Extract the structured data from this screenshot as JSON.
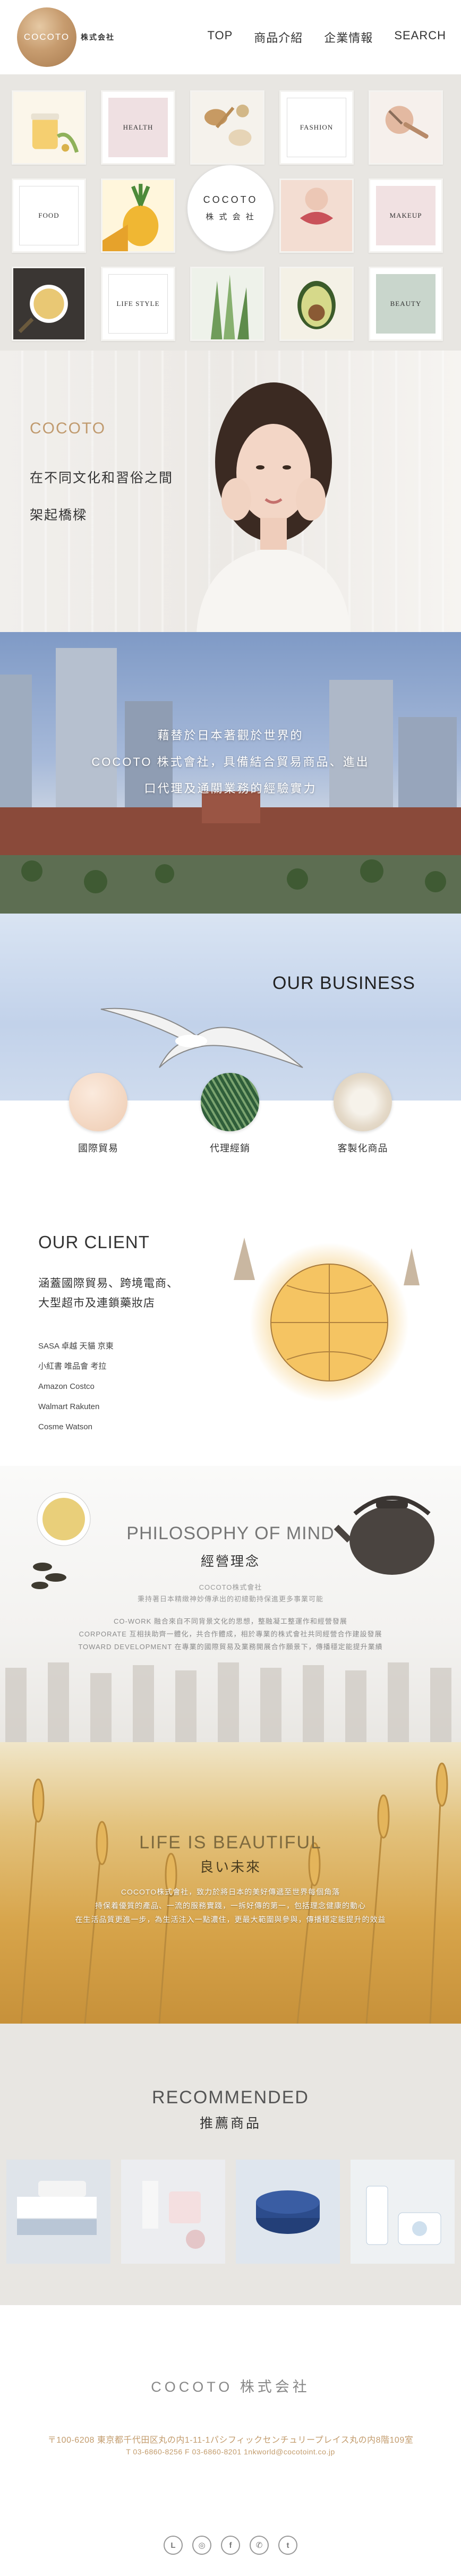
{
  "header": {
    "logo_circle_text": "COCOTO",
    "logo_text": "株式会社",
    "nav": [
      "TOP",
      "商品介紹",
      "企業情報",
      "SEARCH"
    ]
  },
  "grid": {
    "text_tiles": {
      "health": "HEALTH",
      "fashion": "FASHION",
      "food": "FOOD",
      "makeup": "MAKEUP",
      "lifestyle": "LIFE STYLE",
      "beauty": "BEAUTY"
    },
    "center_brand": "COCOTO",
    "center_sub": "株 式 会 社"
  },
  "hero": {
    "brand": "COCOTO",
    "line1": "在不同文化和習俗之間",
    "line2": "架起橋樑"
  },
  "city": {
    "lines": [
      "藉替於日本著觀於世界的",
      "COCOTO 株式會社，具備結合貿易商品、進出",
      "口代理及通關業務的經驗實力"
    ]
  },
  "business": {
    "title": "OUR BUSINESS",
    "items": [
      "國際貿易",
      "代理經銷",
      "客製化商品"
    ]
  },
  "client": {
    "title": "OUR CLIENT",
    "sub1": "涵蓋國際貿易、跨境電商、",
    "sub2": "大型超市及連鎖藥妝店",
    "list": [
      "SASA 卓越 天貓 京東",
      "小紅書 唯品會 考拉",
      "Amazon Costco",
      "Walmart Rakuten",
      "Cosme Watson"
    ]
  },
  "philosophy": {
    "title": "PHILOSOPHY OF MIND",
    "subtitle": "經營理念",
    "small_brand": "COCOTO株式會社",
    "small_desc": "秉持著日本精緻神妙傳承出的初總動持保進更多事業可能",
    "lines": [
      "CO-WORK 融合來自不同背景文化的思想，整融凝工整運作和經營發展",
      "CORPORATE 互相扶助齊一體化，共合作體成，相於專業的株式會社共同經營合作建設發展",
      "TOWARD DEVELOPMENT 在專業的國際貿易及業務開展合作願景下，傳播穩定能提升業績"
    ]
  },
  "life": {
    "title": "LIFE IS BEAUTIFUL",
    "subtitle": "良い未來",
    "lines": [
      "COCOTO株式會社，致力於將日本的美好傳遞至世界每個角落",
      "持保着優質的產品、一流的服務實踐，一拆好傳的第一，包括理念健康的動心",
      "在生活品質更進一步，為生活注入一點濃住，更最大範圍與參與，傳播穩定能提升的效益"
    ]
  },
  "recommended": {
    "title": "RECOMMENDED",
    "subtitle": "推薦商品"
  },
  "footer": {
    "logo": "COCOTO 株式会社",
    "address": "〒100-6208 東京都千代田区丸の内1-11-1パシフィックセンチュリープレイス丸の内8階109室",
    "contact": "T 03-6860-8256   F 03-6860-8201   1nkworld@cocotoint.co.jp",
    "social": [
      "line",
      "instagram",
      "facebook",
      "whatsapp",
      "twitter"
    ],
    "social_glyphs": [
      "L",
      "◎",
      "f",
      "✆",
      "t"
    ]
  },
  "colors": {
    "accent_gold": "#c09a6e",
    "grid_bg": "#e8e6e2"
  }
}
